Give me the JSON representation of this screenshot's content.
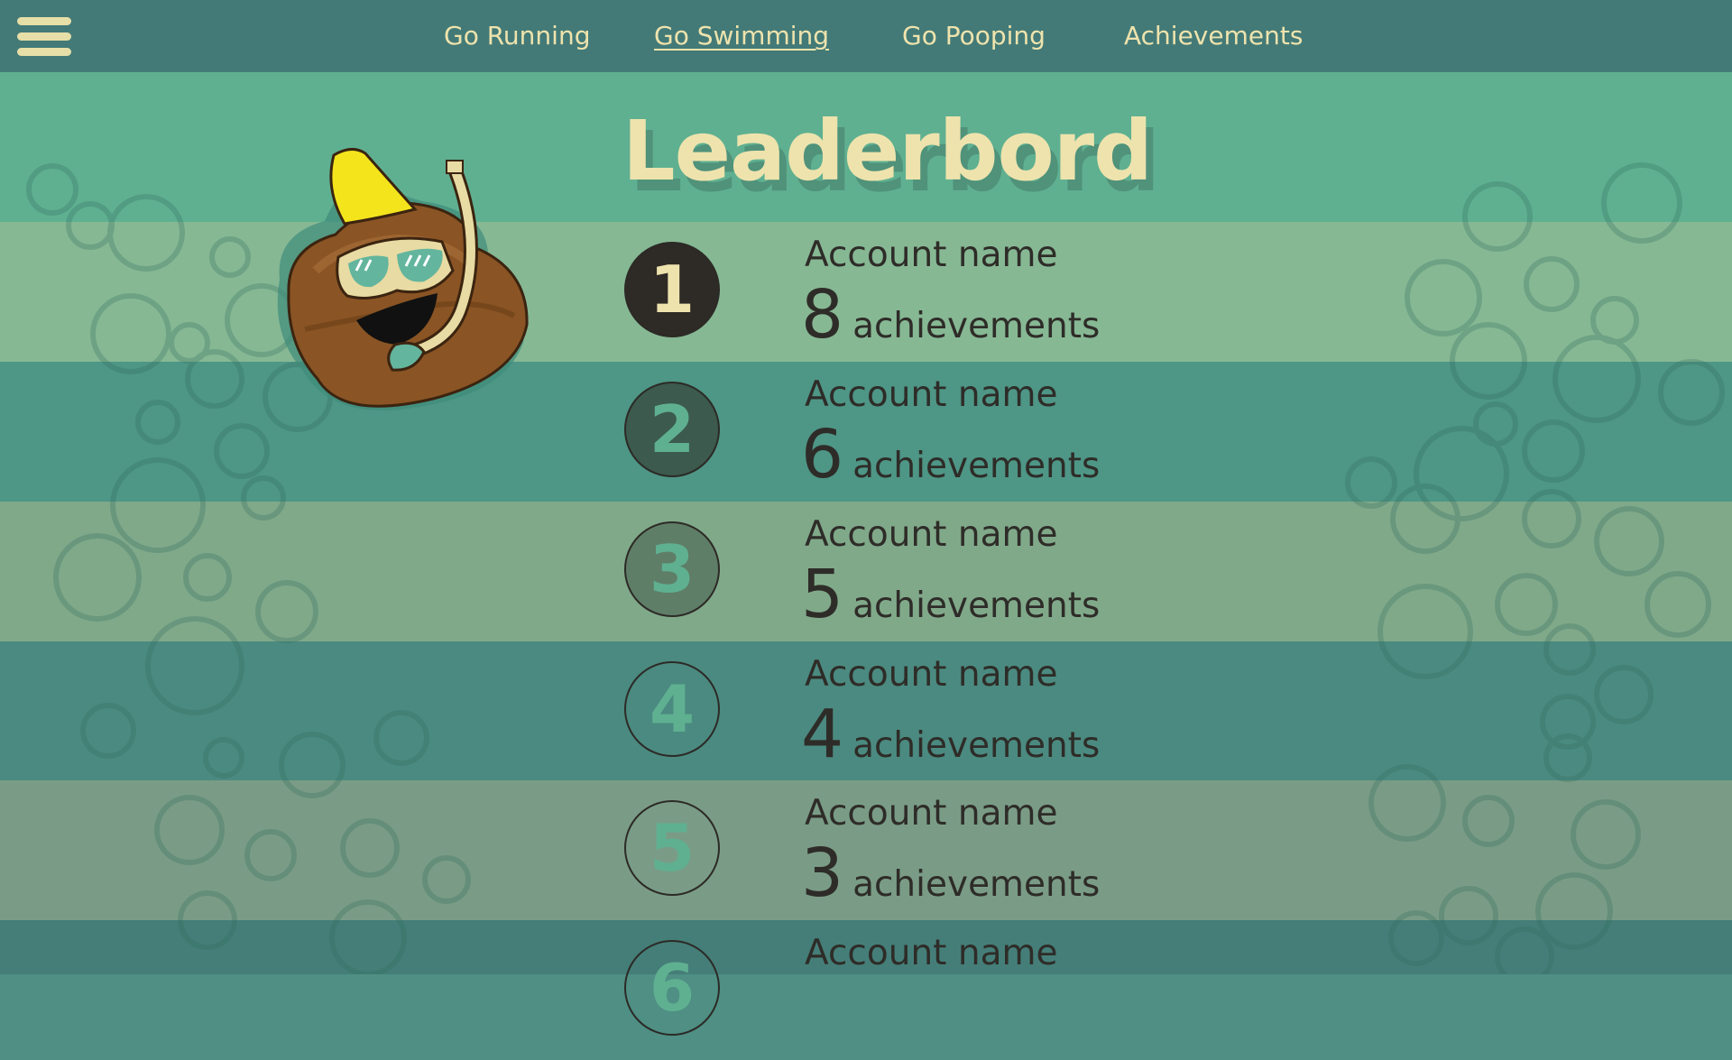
{
  "nav": {
    "links": [
      {
        "label": "Go Running"
      },
      {
        "label": "Go Swimming",
        "active": true
      },
      {
        "label": "Go Pooping"
      },
      {
        "label": "Achievements"
      }
    ]
  },
  "page": {
    "title": "Leaderbord"
  },
  "leaderboard": [
    {
      "rank": "1",
      "account": "Account name",
      "count": "8",
      "label": "achievements"
    },
    {
      "rank": "2",
      "account": "Account name",
      "count": "6",
      "label": "achievements"
    },
    {
      "rank": "3",
      "account": "Account name",
      "count": "5",
      "label": "achievements"
    },
    {
      "rank": "4",
      "account": "Account name",
      "count": "4",
      "label": "achievements"
    },
    {
      "rank": "5",
      "account": "Account name",
      "count": "3",
      "label": "achievements"
    },
    {
      "rank": "6",
      "account": "Account name",
      "count": "",
      "label": ""
    }
  ],
  "colors": {
    "nav_bg": "#437a77",
    "accent_text": "#eee3ad",
    "rank1_fill": "#2e2a26",
    "rank2_fill": "#3c5a4e",
    "rank3_fill": "#5f7e67",
    "rank_digit_teal": "#5fb091"
  },
  "icons": {
    "menu": "hamburger-menu-icon",
    "mascot": "snorkel-poop-mascot"
  }
}
